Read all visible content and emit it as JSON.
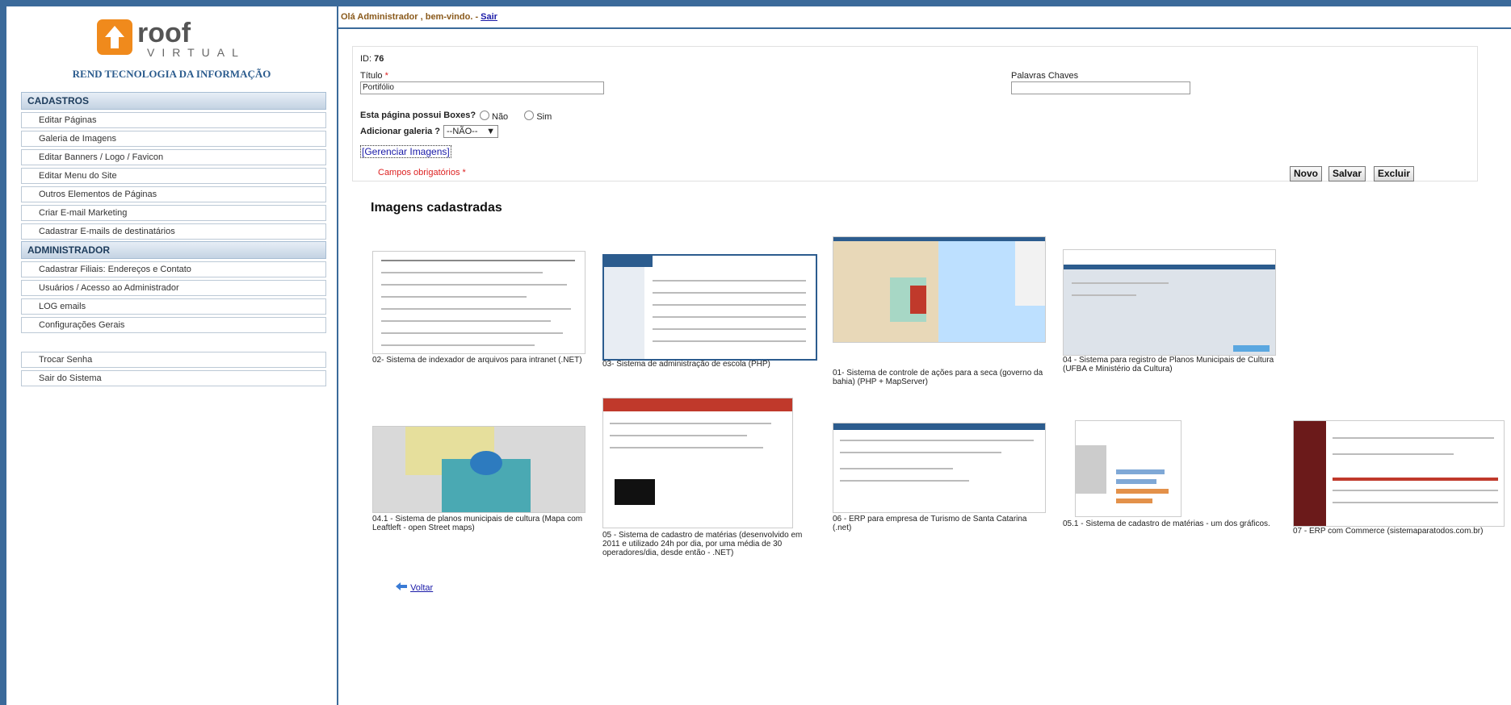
{
  "brand": {
    "logo_text_main": "ROOF",
    "logo_text_sub": "VIRTUAL",
    "company": "REND TECNOLOGIA DA INFORMAÇÃO"
  },
  "sidebar": {
    "cadastros_title": "CADASTROS",
    "cadastros": [
      "Editar Páginas",
      "Galeria de Imagens",
      "Editar Banners / Logo / Favicon",
      "Editar Menu do Site",
      "Outros Elementos de Páginas",
      "Criar E-mail Marketing",
      "Cadastrar E-mails de destinatários"
    ],
    "admin_title": "ADMINISTRADOR",
    "admin": [
      "Cadastrar Filiais: Endereços e Contato",
      "Usuários / Acesso ao Administrador",
      "LOG emails",
      "Configurações Gerais"
    ],
    "account": [
      "Trocar Senha",
      "Sair do Sistema"
    ]
  },
  "header": {
    "greeting": "Olá Administrador , bem-vindo. - ",
    "logout": "Sair"
  },
  "form": {
    "id_label": "ID:",
    "id_value": "76",
    "titulo_label": "Título",
    "required_mark": "*",
    "titulo_value": "Portifólio",
    "keywords_label": "Palavras Chaves",
    "keywords_value": "",
    "boxes_question": "Esta página possui Boxes?",
    "opt_no": "Não",
    "opt_yes": "Sim",
    "galeria_label": "Adicionar galeria ?",
    "galeria_value": "--NÃO--",
    "gerenciar": "[Gerenciar Imagens]",
    "required_note": "Campos obrigatórios *",
    "buttons": {
      "novo": "Novo",
      "salvar": "Salvar",
      "excluir": "Excluir"
    }
  },
  "gallery": {
    "title": "Imagens cadastradas",
    "items": [
      {
        "caption": "02- Sistema de indexador de arquivos para intranet (.NET)"
      },
      {
        "caption": "03- Sistema de administração de escola (PHP)"
      },
      {
        "caption": "01- Sistema de controle de ações para a seca (governo da bahia) (PHP + MapServer)"
      },
      {
        "caption": "04 - Sistema para registro de Planos Municipais de Cultura (UFBA e Ministério da Cultura)"
      },
      {
        "caption": "04.1 - Sistema de planos municipais de cultura (Mapa com Leaftleft - open Street maps)"
      },
      {
        "caption": "05 - Sistema de cadastro de matérias (desenvolvido em 2011 e utilizado 24h por dia, por uma média de 30 operadores/dia, desde então - .NET)"
      },
      {
        "caption": "06 - ERP para empresa de Turismo de Santa Catarina (.net)"
      },
      {
        "caption": "05.1 - Sistema de cadastro de matérias - um dos gráficos."
      },
      {
        "caption": "07 - ERP com Commerce (sistemaparatodos.com.br)"
      }
    ]
  },
  "back": {
    "label": "Voltar"
  }
}
